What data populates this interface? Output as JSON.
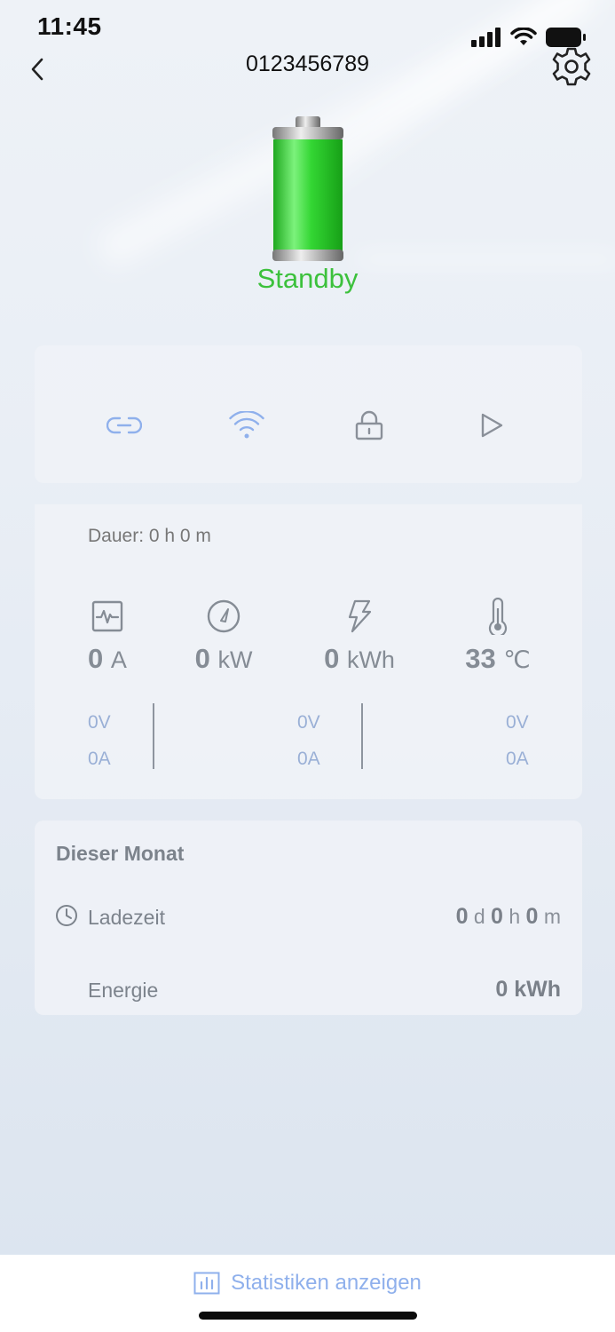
{
  "status_bar": {
    "time": "11:45"
  },
  "header": {
    "title": "0123456789"
  },
  "charger": {
    "status": "Standby",
    "status_color": "#3cc13c"
  },
  "controls": [
    {
      "icon": "link-icon",
      "color": "#8fb0ec"
    },
    {
      "icon": "wifi-icon",
      "color": "#8fb0ec"
    },
    {
      "icon": "lock-icon",
      "color": "#8a9099"
    },
    {
      "icon": "play-icon",
      "color": "#8a9099"
    }
  ],
  "session": {
    "duration": "Dauer: 0 h 0 m",
    "metrics": [
      {
        "icon": "pulse-icon",
        "value": "0",
        "unit": "A"
      },
      {
        "icon": "gauge-icon",
        "value": "0",
        "unit": "kW"
      },
      {
        "icon": "lightning-icon",
        "value": "0",
        "unit": "kWh"
      },
      {
        "icon": "thermometer-icon",
        "value": "33",
        "unit": "℃"
      }
    ],
    "phases": [
      {
        "voltage": "0V",
        "current": "0A"
      },
      {
        "voltage": "0V",
        "current": "0A"
      },
      {
        "voltage": "0V",
        "current": "0A"
      }
    ]
  },
  "month": {
    "title": "Dieser Monat",
    "charge_time_label": "Ladezeit",
    "charge_time": {
      "d": "0",
      "d_unit": "d",
      "h": "0",
      "h_unit": "h",
      "m": "0",
      "m_unit": "m"
    },
    "energy_label": "Energie",
    "energy_value": "0 kWh"
  },
  "footer": {
    "stats_link": "Statistiken anzeigen",
    "link_color": "#8fb0ec"
  }
}
